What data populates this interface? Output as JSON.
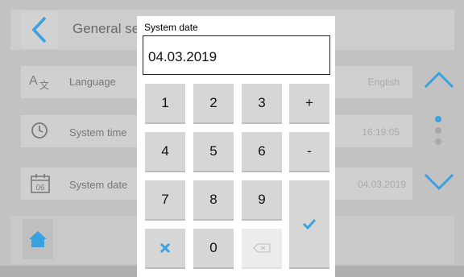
{
  "screen": {
    "title": "General set",
    "rows": [
      {
        "label": "Language",
        "value": "English",
        "icon": "translate-icon"
      },
      {
        "label": "System time",
        "value": "16:19:05",
        "icon": "clock-icon"
      },
      {
        "label": "System date",
        "value": "04.03.2019",
        "icon": "calendar-icon",
        "icon_text": "06"
      }
    ]
  },
  "dialog": {
    "title": "System date",
    "value": "04.03.2019",
    "keys": [
      "1",
      "2",
      "3",
      "+",
      "4",
      "5",
      "6",
      "-",
      "7",
      "8",
      "9",
      "0"
    ]
  },
  "colors": {
    "accent": "#3aa0e0",
    "key": "#d6d6d6",
    "modal": "#ffffff"
  }
}
